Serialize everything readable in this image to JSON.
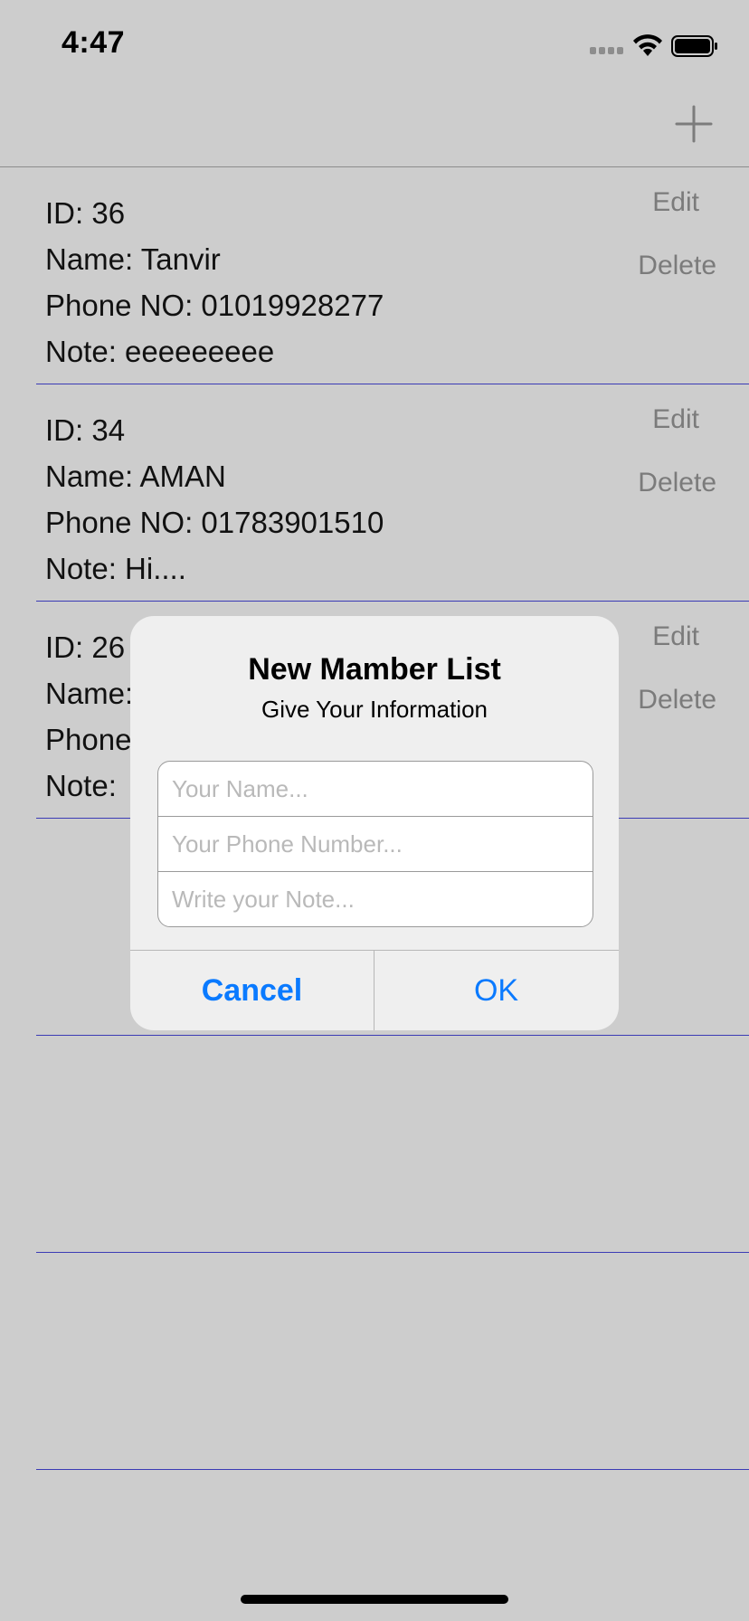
{
  "status_bar": {
    "time": "4:47",
    "signal_icon": "signal-dots-icon",
    "wifi_icon": "wifi-icon",
    "battery_icon": "battery-icon"
  },
  "nav": {
    "add_icon": "plus-icon"
  },
  "members": [
    {
      "id_label": "ID: 36",
      "name_label": "Name: Tanvir",
      "phone_label": "Phone NO: 01019928277",
      "note_label": "Note: eeeeeeeee",
      "edit_label": "Edit",
      "delete_label": "Delete"
    },
    {
      "id_label": "ID: 34",
      "name_label": "Name: AMAN",
      "phone_label": "Phone NO: 01783901510",
      "note_label": "Note: Hi....",
      "edit_label": "Edit",
      "delete_label": "Delete"
    },
    {
      "id_label": "ID: 26",
      "name_label": "Name:",
      "phone_label": "Phone",
      "note_label": "Note:",
      "edit_label": "Edit",
      "delete_label": "Delete"
    }
  ],
  "alert": {
    "title": "New Mamber List",
    "message": "Give Your Information",
    "fields": {
      "name_placeholder": "Your Name...",
      "phone_placeholder": "Your Phone Number...",
      "note_placeholder": "Write your Note..."
    },
    "cancel_label": "Cancel",
    "ok_label": "OK"
  },
  "colors": {
    "background": "#cdcdcd",
    "alert_background": "#efefef",
    "accent": "#0a7aff",
    "separator": "#3b3bb5",
    "secondary_text": "#7b7b7b"
  }
}
